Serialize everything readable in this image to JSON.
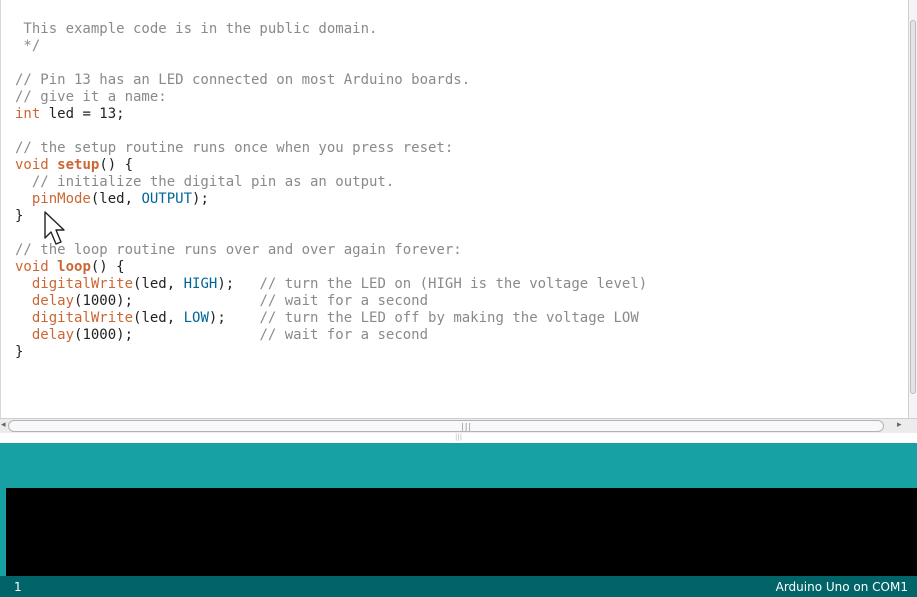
{
  "editor": {
    "lines": [
      [
        {
          "t": " This example code is in the public domain.",
          "c": "cm"
        }
      ],
      [
        {
          "t": " */",
          "c": "cm"
        }
      ],
      [],
      [
        {
          "t": "// Pin 13 has an LED connected on most Arduino boards.",
          "c": "cm"
        }
      ],
      [
        {
          "t": "// give it a name:",
          "c": "cm"
        }
      ],
      [
        {
          "t": "int",
          "c": "kw"
        },
        {
          "t": " led = 13;",
          "c": ""
        }
      ],
      [],
      [
        {
          "t": "// the setup routine runs once when you press reset:",
          "c": "cm"
        }
      ],
      [
        {
          "t": "void",
          "c": "kw"
        },
        {
          "t": " ",
          "c": ""
        },
        {
          "t": "setup",
          "c": "kwb"
        },
        {
          "t": "() {",
          "c": ""
        }
      ],
      [
        {
          "t": "  // initialize the digital pin as an output.",
          "c": "cm"
        }
      ],
      [
        {
          "t": "  ",
          "c": ""
        },
        {
          "t": "pinMode",
          "c": "fn"
        },
        {
          "t": "(led, ",
          "c": ""
        },
        {
          "t": "OUTPUT",
          "c": "const"
        },
        {
          "t": ");",
          "c": ""
        }
      ],
      [
        {
          "t": "}",
          "c": ""
        }
      ],
      [],
      [
        {
          "t": "// the loop routine runs over and over again forever:",
          "c": "cm"
        }
      ],
      [
        {
          "t": "void",
          "c": "kw"
        },
        {
          "t": " ",
          "c": ""
        },
        {
          "t": "loop",
          "c": "kwb"
        },
        {
          "t": "() {",
          "c": ""
        }
      ],
      [
        {
          "t": "  ",
          "c": ""
        },
        {
          "t": "digitalWrite",
          "c": "fn"
        },
        {
          "t": "(led, ",
          "c": ""
        },
        {
          "t": "HIGH",
          "c": "const"
        },
        {
          "t": ");   ",
          "c": ""
        },
        {
          "t": "// turn the LED on (HIGH is the voltage level)",
          "c": "cm"
        }
      ],
      [
        {
          "t": "  ",
          "c": ""
        },
        {
          "t": "delay",
          "c": "fn"
        },
        {
          "t": "(1000);               ",
          "c": ""
        },
        {
          "t": "// wait for a second",
          "c": "cm"
        }
      ],
      [
        {
          "t": "  ",
          "c": ""
        },
        {
          "t": "digitalWrite",
          "c": "fn"
        },
        {
          "t": "(led, ",
          "c": ""
        },
        {
          "t": "LOW",
          "c": "const"
        },
        {
          "t": ");    ",
          "c": ""
        },
        {
          "t": "// turn the LED off by making the voltage LOW",
          "c": "cm"
        }
      ],
      [
        {
          "t": "  ",
          "c": ""
        },
        {
          "t": "delay",
          "c": "fn"
        },
        {
          "t": "(1000);               ",
          "c": ""
        },
        {
          "t": "// wait for a second",
          "c": "cm"
        }
      ],
      [
        {
          "t": "}",
          "c": ""
        }
      ]
    ]
  },
  "icons": {
    "cursor": "mouse-pointer-icon",
    "scroll_left": "arrow-left-icon",
    "scroll_right": "arrow-right-icon"
  },
  "colors": {
    "status_bar": "#17a1a5",
    "footer": "#006468",
    "console": "#000000",
    "keyword": "#cc6633",
    "constant": "#006699",
    "comment": "#8a8a8a"
  },
  "footer": {
    "line_number": "1",
    "board_info": "Arduino Uno on COM1"
  }
}
